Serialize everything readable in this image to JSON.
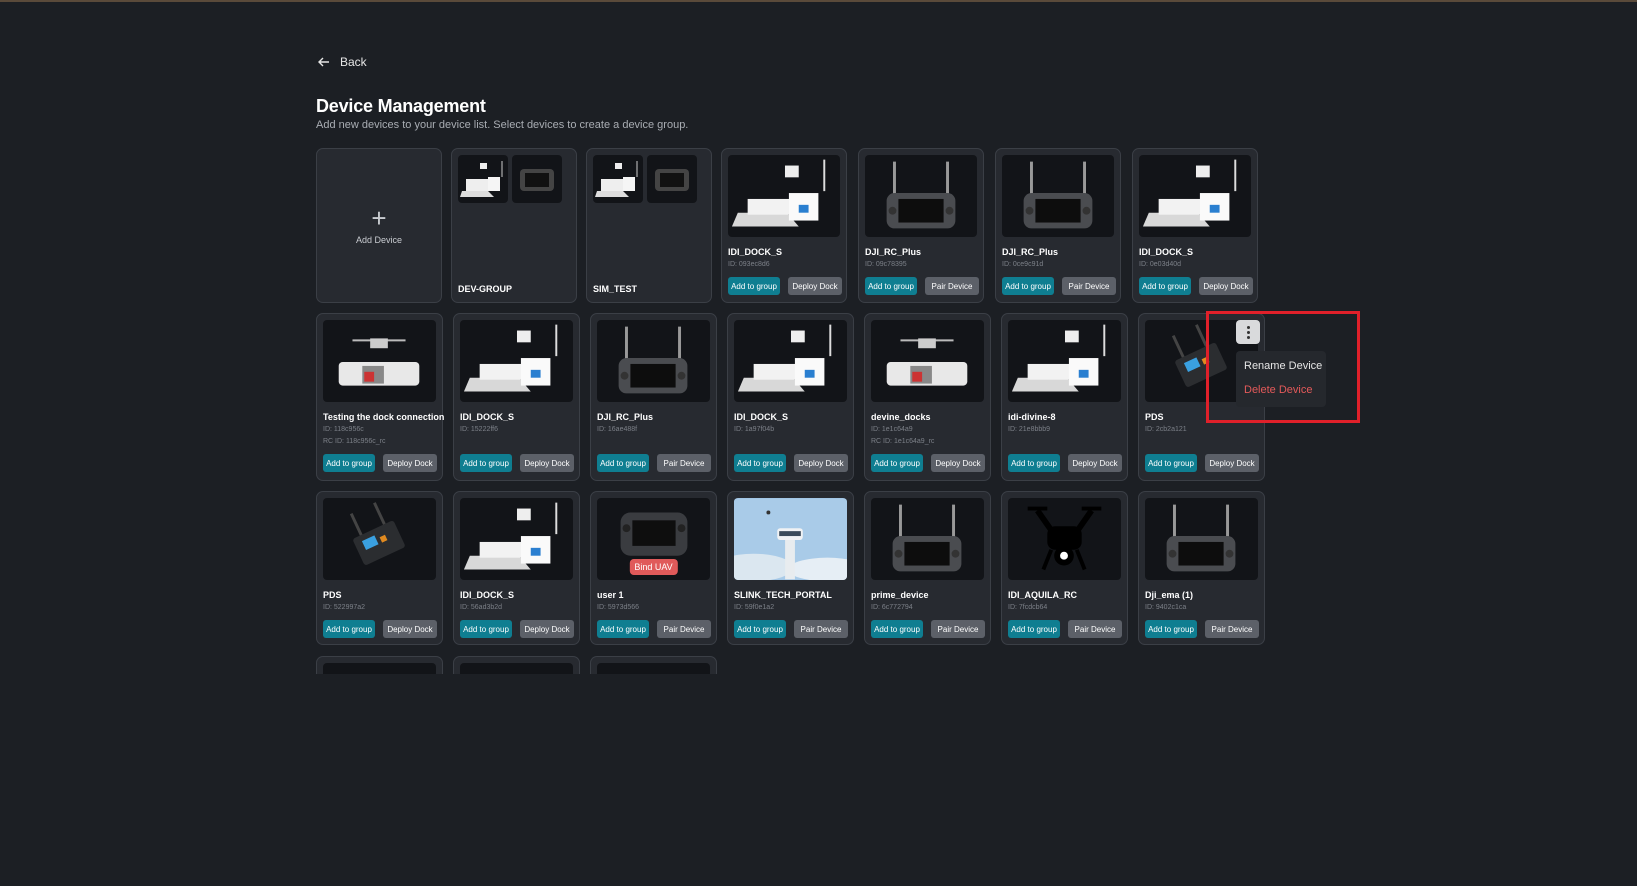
{
  "nav": {
    "back_label": "Back"
  },
  "header": {
    "title": "Device Management",
    "subtitle": "Add new devices to your device list. Select devices to create a device group."
  },
  "add_card": {
    "label": "Add Device"
  },
  "groups": [
    {
      "name": "DEV-GROUP"
    },
    {
      "name": "SIM_TEST"
    }
  ],
  "buttons": {
    "add_to_group": "Add to group",
    "deploy_dock": "Deploy Dock",
    "pair_device": "Pair Device"
  },
  "devices_row1": [
    {
      "name": "IDI_DOCK_S",
      "id": "ID: 093ec8d6",
      "image": "dock-icon"
    },
    {
      "name": "DJI_RC_Plus",
      "id": "ID: 09c78395",
      "image": "controller-icon"
    },
    {
      "name": "DJI_RC_Plus",
      "id": "ID: 0ce9c91d",
      "image": "controller-icon"
    },
    {
      "name": "IDI_DOCK_S",
      "id": "ID: 0e03d40d",
      "image": "dock-icon"
    }
  ],
  "devices_row2": [
    {
      "name": "Testing the dock connection",
      "id": "ID: 118c956c",
      "rc_id": "RC ID: 118c956c_rc",
      "image": "dock-drone-icon"
    },
    {
      "name": "IDI_DOCK_S",
      "id": "ID: 15222ff6",
      "image": "dock-icon"
    },
    {
      "name": "DJI_RC_Plus",
      "id": "ID: 16ae488f",
      "image": "controller-icon"
    },
    {
      "name": "IDI_DOCK_S",
      "id": "ID: 1a97f04b",
      "image": "dock-icon"
    },
    {
      "name": "devine_docks",
      "id": "ID: 1e1c64a9",
      "rc_id": "RC ID: 1e1c64a9_rc",
      "image": "dock-drone-icon"
    },
    {
      "name": "idi-divine-8",
      "id": "ID: 21e8bbb9",
      "image": "dock-icon"
    },
    {
      "name": "PDS",
      "id": "ID: 2cb2a121",
      "image": "radio-module-icon"
    }
  ],
  "devices_row3": [
    {
      "name": "PDS",
      "id": "ID: 522997a2",
      "image": "radio-module-icon"
    },
    {
      "name": "IDI_DOCK_S",
      "id": "ID: 56ad3b2d",
      "image": "dock-icon"
    },
    {
      "name": "user 1",
      "id": "ID: 5973d566",
      "image": "remote-icon",
      "badge": "Bind UAV"
    },
    {
      "name": "SLINK_TECH_PORTAL",
      "id": "ID: 59f0e1a2",
      "image": "tower-photo"
    },
    {
      "name": "prime_device",
      "id": "ID: 6c772794",
      "image": "controller-icon"
    },
    {
      "name": "IDI_AQUILA_RC",
      "id": "ID: 7fcdcb64",
      "image": "drone-icon"
    },
    {
      "name": "Dji_ema (1)",
      "id": "ID: 9402c1ca",
      "image": "controller-icon"
    }
  ],
  "context_menu": {
    "rename": "Rename Device",
    "delete": "Delete Device"
  }
}
